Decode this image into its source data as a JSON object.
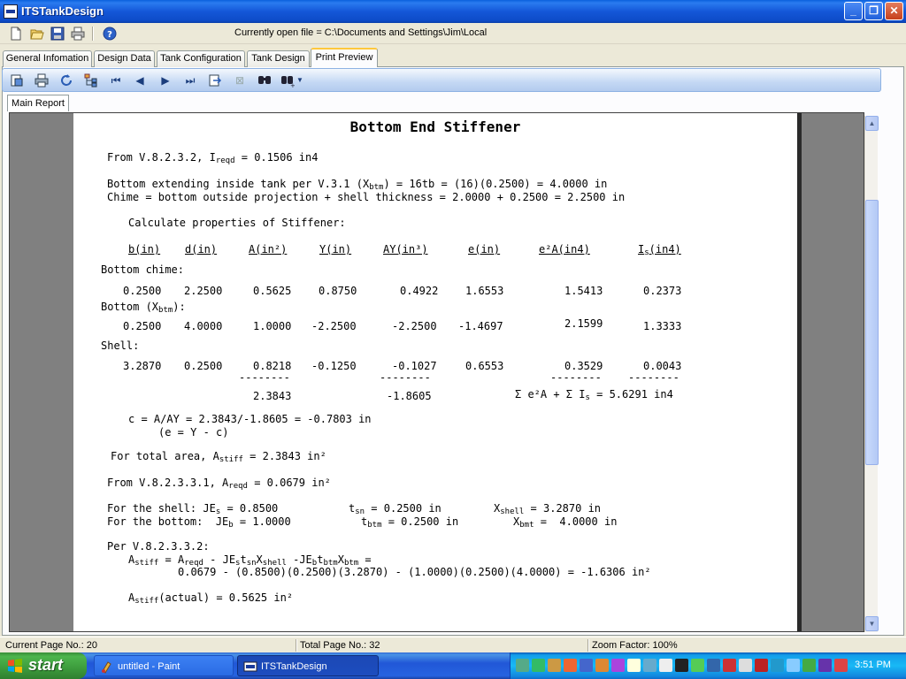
{
  "window": {
    "title": "ITSTankDesign"
  },
  "toolbar": {
    "open_file_text": "Currently open file = C:\\Documents and Settings\\Jim\\Local"
  },
  "tabs": [
    {
      "label": "General Infomation"
    },
    {
      "label": "Design Data"
    },
    {
      "label": "Tank Configuration"
    },
    {
      "label": "Tank Design"
    },
    {
      "label": "Print Preview"
    }
  ],
  "subtab": {
    "label": "Main Report"
  },
  "report": {
    "title": "Bottom End Stiffener",
    "l_ireqd_pre": "From V.8.2.3.2, I",
    "l_ireqd_sub": "reqd",
    "l_ireqd_post": " = 0.1506 in4",
    "l_xbtm_pre": "Bottom extending inside tank per V.3.1 (X",
    "l_xbtm_sub": "btm",
    "l_xbtm_post": ") = 16tb = (16)(0.2500) = 4.0000 in",
    "l_chime": "Chime = bottom outside projection + shell thickness = 2.0000 + 0.2500 = 2.2500 in",
    "l_calc": "Calculate properties of Stiffener:",
    "headers": [
      "b(in)",
      "d(in)",
      "A(in²)",
      "Y(in)",
      "AY(in³)",
      "e(in)",
      "e²A(in4)"
    ],
    "header_is_pre": "I",
    "header_is_sub": "s",
    "header_is_post": "(in4)",
    "sec_chime": "Bottom chime:",
    "sec_bottom_pre": "Bottom (X",
    "sec_bottom_sub": "btm",
    "sec_bottom_post": "):",
    "sec_shell": "Shell:",
    "row_chime": [
      "0.2500",
      "2.2500",
      "0.5625",
      "0.8750",
      "0.4922",
      "1.6553",
      "1.5413",
      "0.2373"
    ],
    "row_bottom": [
      "0.2500",
      "4.0000",
      "1.0000",
      "-2.2500",
      "-2.2500",
      "-1.4697",
      "2.1599",
      "1.3333"
    ],
    "row_shell": [
      "3.2870",
      "0.2500",
      "0.8218",
      "-0.1250",
      "-0.1027",
      "0.6553",
      "0.3529",
      "0.0043"
    ],
    "dashes": "--------",
    "sum_a": "2.3843",
    "sum_ay": "-1.8605",
    "sum_total_pre": "Σ e²A + Σ I",
    "sum_total_sub": "s",
    "sum_total_post": " = 5.6291 in4",
    "l_c": "c = A/AY = 2.3843/-1.8605 = -0.7803 in",
    "l_e": "(e = Y - c)",
    "l_total_pre": "For total area, A",
    "l_total_sub": "stiff",
    "l_total_post": " = 2.3843 in²",
    "l_areqd_pre": "From V.8.2.3.3.1, A",
    "l_areqd_sub": "reqd",
    "l_areqd_post": " = 0.0679 in²",
    "l_shell_a": "For the shell: JE",
    "l_shell_a_sub": "s",
    "l_shell_a_post": " = 0.8500",
    "l_shell_b": "t",
    "l_shell_b_sub": "sn",
    "l_shell_b_post": " = 0.2500 in",
    "l_shell_c": "X",
    "l_shell_c_sub": "shell",
    "l_shell_c_post": " = 3.2870 in",
    "l_bot_a": "For the bottom:  JE",
    "l_bot_a_sub": "b",
    "l_bot_a_post": " = 1.0000",
    "l_bot_b": "t",
    "l_bot_b_sub": "btm",
    "l_bot_b_post": " = 0.2500 in",
    "l_bot_c": "X",
    "l_bot_c_sub": "bmt",
    "l_bot_c_post": " =  4.0000 in",
    "l_per": "Per V.8.2.3.3.2:",
    "l_astiff_eq": "A",
    "l_astiff_eq_sub": "stiff",
    "l_astiff_eq_rest": " = A",
    "l_astiff_eq_sub2": "reqd",
    "l_astiff_eq_rest2": " - JE",
    "l_astiff_eq_sub3": "s",
    "l_astiff_eq_rest3": "t",
    "l_astiff_eq_sub4": "sn",
    "l_astiff_eq_rest4": "X",
    "l_astiff_eq_sub5": "shell",
    "l_astiff_eq_rest5": " -JE",
    "l_astiff_eq_sub6": "b",
    "l_astiff_eq_rest6": "t",
    "l_astiff_eq_sub7": "btm",
    "l_astiff_eq_rest7": "X",
    "l_astiff_eq_sub8": "btm",
    "l_astiff_eq_rest8": " =",
    "l_astiff_val": "0.0679 - (0.8500)(0.2500)(3.2870) - (1.0000)(0.2500)(4.0000) = -1.6306 in²",
    "l_actual_pre": "A",
    "l_actual_sub": "stiff",
    "l_actual_post": "(actual) = 0.5625 in²"
  },
  "status": {
    "current_page": "Current Page No.: 20",
    "total_page": "Total Page No.: 32",
    "zoom": "Zoom Factor: 100%"
  },
  "taskbar": {
    "start": "start",
    "tasks": [
      {
        "label": "untitled - Paint"
      },
      {
        "label": "ITSTankDesign"
      }
    ],
    "clock": "3:51 PM"
  }
}
